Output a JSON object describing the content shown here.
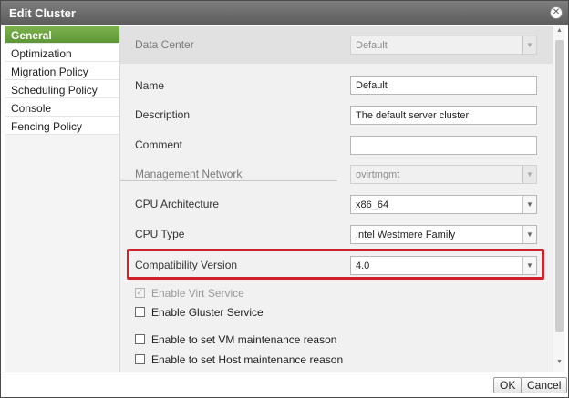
{
  "window": {
    "title": "Edit Cluster"
  },
  "sidebar": {
    "items": [
      {
        "label": "General",
        "active": true
      },
      {
        "label": "Optimization"
      },
      {
        "label": "Migration Policy"
      },
      {
        "label": "Scheduling Policy"
      },
      {
        "label": "Console"
      },
      {
        "label": "Fencing Policy"
      }
    ]
  },
  "form": {
    "data_center": {
      "label": "Data Center",
      "value": "Default"
    },
    "name": {
      "label": "Name",
      "value": "Default"
    },
    "description": {
      "label": "Description",
      "value": "The default server cluster"
    },
    "comment": {
      "label": "Comment",
      "value": ""
    },
    "management_network": {
      "label": "Management Network",
      "value": "ovirtmgmt"
    },
    "cpu_architecture": {
      "label": "CPU Architecture",
      "value": "x86_64"
    },
    "cpu_type": {
      "label": "CPU Type",
      "value": "Intel Westmere Family"
    },
    "compatibility_version": {
      "label": "Compatibility Version",
      "value": "4.0"
    },
    "enable_virt": {
      "label": "Enable Virt Service",
      "checked": true
    },
    "enable_gluster": {
      "label": "Enable Gluster Service",
      "checked": false
    },
    "vm_maintenance_reason": {
      "label": "Enable to set VM maintenance reason",
      "checked": false
    },
    "host_maintenance_reason": {
      "label": "Enable to set Host maintenance reason",
      "checked": false
    }
  },
  "footer": {
    "ok_label": "OK",
    "cancel_label": "Cancel"
  },
  "colors": {
    "active_tab": "#6aa340",
    "highlight": "#d0202a",
    "title_bar": "#6e6e6e"
  }
}
